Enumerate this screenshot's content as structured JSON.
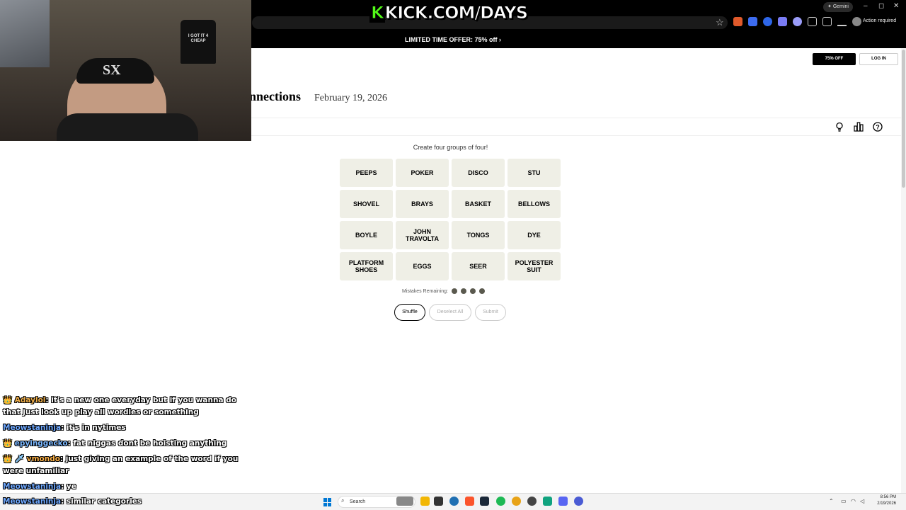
{
  "overlay": {
    "banner_prefix": "K",
    "banner_text": "KICK.COM/DAYS",
    "cam_shirt_text": "I GOT IT 4 CHEAP",
    "cam_hat_logo": "SX"
  },
  "browser": {
    "gemini_label": "Gemini",
    "action_required": "Action required",
    "minimize": "–",
    "maximize": "◻",
    "close": "✕"
  },
  "offer": {
    "text": "LIMITED TIME OFFER:  75% off",
    "arrow": "›"
  },
  "header": {
    "subscribe_label": "75% OFF",
    "login_label": "LOG IN",
    "title": "nnections",
    "date": "February 19, 2026"
  },
  "game": {
    "instructions": "Create four groups of four!",
    "tiles": [
      "PEEPS",
      "POKER",
      "DISCO",
      "STU",
      "SHOVEL",
      "BRAYS",
      "BASKET",
      "BELLOWS",
      "BOYLE",
      "JOHN TRAVOLTA",
      "TONGS",
      "DYE",
      "PLATFORM SHOES",
      "EGGS",
      "SEER",
      "POLYESTER SUIT"
    ],
    "mistakes_label": "Mistakes Remaining:",
    "mistakes_remaining": 4,
    "buttons": {
      "shuffle": "Shuffle",
      "deselect": "Deselect All",
      "submit": "Submit"
    }
  },
  "chat": {
    "messages": [
      {
        "badge": "👑",
        "user": "Adaylol",
        "text": ": it's a new one everyday but if you wanna do that just look up play all wordles or something"
      },
      {
        "badge": "",
        "user": "Meowstaninja",
        "text": ": it's in nytimes"
      },
      {
        "badge": "👑",
        "user": "epyinggecko",
        "text": ": fat niggas dont be hoisting anything"
      },
      {
        "badge": "👑 🗡",
        "user": "vmondo",
        "text": ": just giving an example of the word if you were unfamiliar"
      },
      {
        "badge": "",
        "user": "Meowstaninja",
        "text": ": ye"
      }
    ],
    "last": {
      "user": "Meowstaninja",
      "text": ": similar categories"
    }
  },
  "taskbar": {
    "search_placeholder": "Search",
    "time": "8:56 PM",
    "date": "2/19/2026"
  },
  "colors": {
    "tile_bg": "#efefe6",
    "dot": "#5a594e",
    "kick_green": "#53fc18",
    "windows_blue": "#0078d4"
  }
}
